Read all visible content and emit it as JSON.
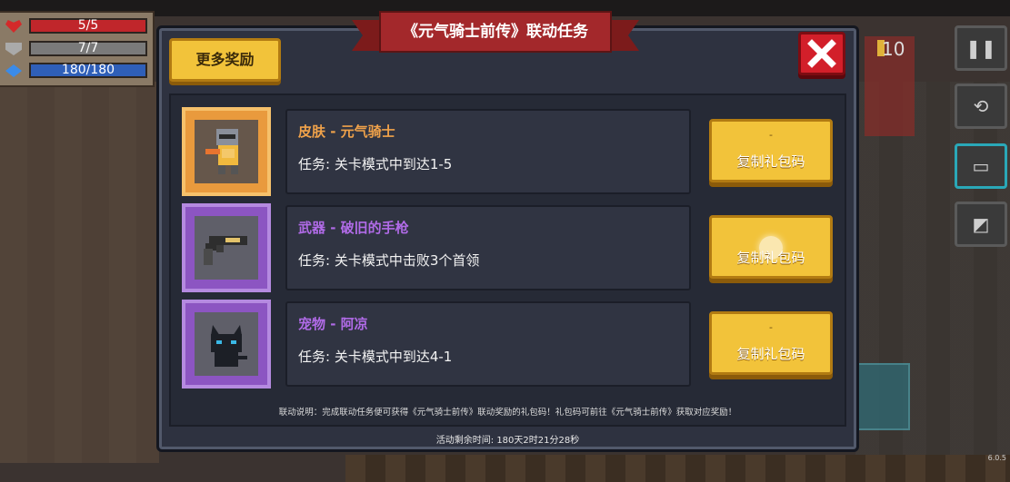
{
  "hud": {
    "hp": "5/5",
    "armor": "7/7",
    "energy": "180/180"
  },
  "currency": {
    "count": "10"
  },
  "version": "6.0.5",
  "modal": {
    "title": "《元气骑士前传》联动任务",
    "more_rewards_label": "更多奖励",
    "tasks": [
      {
        "reward": "皮肤 - 元气骑士",
        "task": "任务: 关卡模式中到达1-5",
        "status": "-",
        "button": "复制礼包码",
        "rarity_color": "#f0a24a",
        "icon": "knight-skin-icon"
      },
      {
        "reward": "武器 - 破旧的手枪",
        "task": "任务: 关卡模式中击败3个首领",
        "status": "-",
        "button": "复制礼包码",
        "rarity_color": "#b16be8",
        "icon": "pistol-icon"
      },
      {
        "reward": "宠物 - 阿凉",
        "task": "任务: 关卡模式中到达4-1",
        "status": "-",
        "button": "复制礼包码",
        "rarity_color": "#b16be8",
        "icon": "black-cat-pet-icon"
      }
    ],
    "note": "联动说明：完成联动任务便可获得《元气骑士前传》联动奖励的礼包码！礼包码可前往《元气骑士前传》获取对应奖励！",
    "timer": "活动剩余时间: 180天2时21分28秒"
  }
}
